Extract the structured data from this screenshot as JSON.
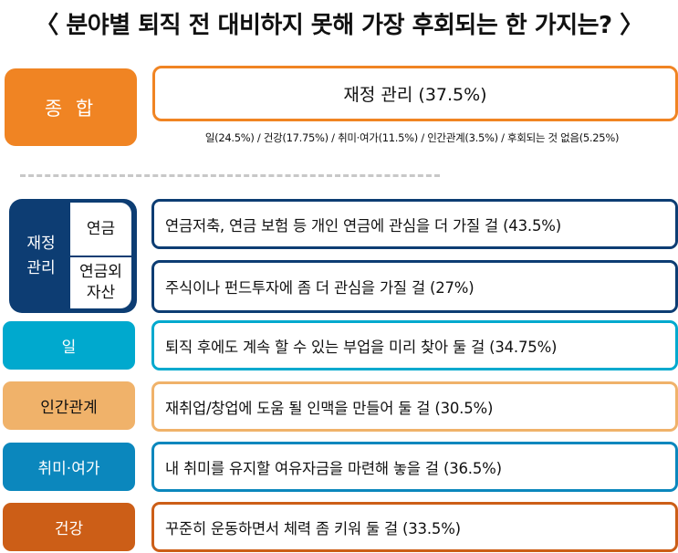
{
  "title": "〈 분야별 퇴직 전 대비하지 못해 가장 후회되는 한 가지는? 〉",
  "summary": {
    "label": "종 합",
    "result": "재정 관리 (37.5%)",
    "breakdown": "일(24.5%) / 건강(17.75%) / 취미·여가(11.5%) / 인간관계(3.5%) / 후회되는 것 없음(5.25%)",
    "color": "#F08423"
  },
  "finance": {
    "label_line1": "재정",
    "label_line2": "관리",
    "color": "#0D3D73",
    "items": [
      {
        "sub_label": "연금",
        "answer": "연금저축, 연금 보험 등 개인 연금에 관심을 더 가질 걸 (43.5%)"
      },
      {
        "sub_label_line1": "연금외",
        "sub_label_line2": "자산",
        "answer": "주식이나 펀드투자에 좀 더 관심을 가질 걸 (27%)"
      }
    ]
  },
  "categories": [
    {
      "label": "일",
      "answer": "퇴직 후에도 계속 할 수 있는 부업을 미리 찾아 둘 걸 (34.75%)",
      "color": "#00A9CE"
    },
    {
      "label": "인간관계",
      "answer": "재취업/창업에 도움 될 인맥을 만들어 둘 걸 (30.5%)",
      "color": "#F0B26A"
    },
    {
      "label": "취미·여가",
      "answer": "내 취미를 유지할 여유자금을 마련해 놓을 걸 (36.5%)",
      "color": "#0B87BD"
    },
    {
      "label": "건강",
      "answer": "꾸준히 운동하면서 체력 좀 키워 둘 걸 (33.5%)",
      "color": "#CC5E17"
    }
  ]
}
